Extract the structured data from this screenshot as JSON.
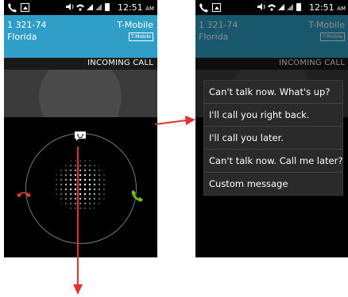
{
  "status": {
    "time": "12:51",
    "ampm": "AM"
  },
  "call": {
    "number": "1 321-74",
    "location": "Florida",
    "carrier": "T-Mobile",
    "carrier_badge": "T-Mobile",
    "incoming_label": "INCOMING CALL"
  },
  "quick_responses": [
    "Can't talk now. What's up?",
    "I'll call you right back.",
    "I'll call you later.",
    "Can't talk now. Call me later?",
    "Custom message"
  ],
  "colors": {
    "caller_bar": "#2f9fc7",
    "decline": "#e53935",
    "answer": "#7cc300",
    "annotation_arrow": "#e53030"
  },
  "icons": {
    "call_status": "phone-icon",
    "screenshot_notification": "image-icon",
    "decline": "phone-hangup-icon",
    "answer": "phone-answer-icon",
    "text_reply": "message-icon"
  }
}
